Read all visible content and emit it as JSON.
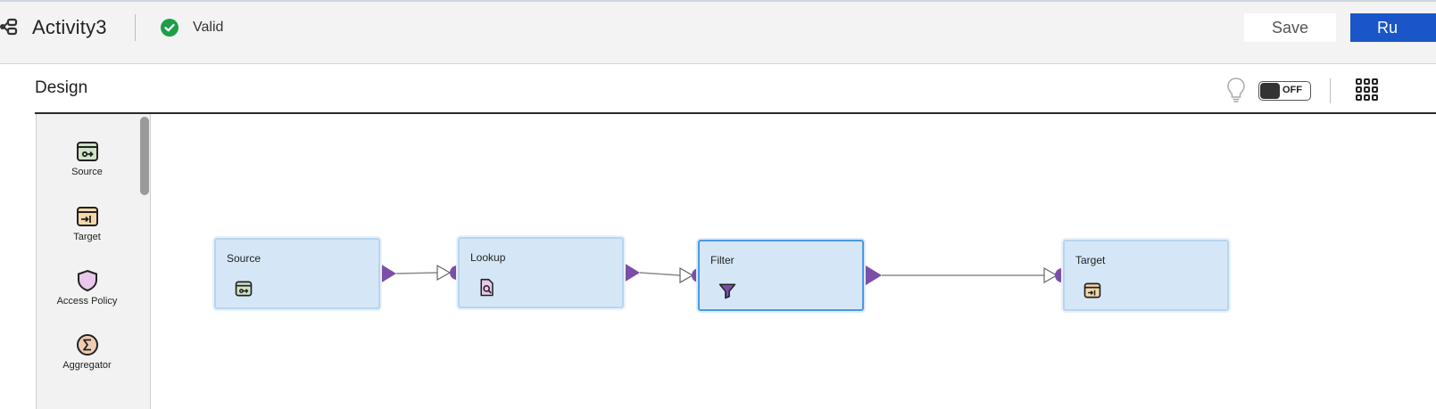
{
  "header": {
    "title": "Activity3",
    "status": "Valid",
    "save_label": "Save",
    "run_label": "Ru",
    "status_color": "#1e9e48",
    "accent_color": "#1b56c8"
  },
  "design": {
    "label": "Design",
    "toggle_label": "OFF",
    "icons": [
      "lightbulb-icon",
      "grid-icon"
    ]
  },
  "palette": {
    "items": [
      {
        "label": "Source",
        "icon": "source-icon"
      },
      {
        "label": "Target",
        "icon": "target-icon"
      },
      {
        "label": "Access Policy",
        "icon": "shield-icon"
      },
      {
        "label": "Aggregator",
        "icon": "sigma-icon"
      }
    ]
  },
  "canvas": {
    "nodes": [
      {
        "title": "Source",
        "icon": "source-icon"
      },
      {
        "title": "Lookup",
        "icon": "lookup-icon"
      },
      {
        "title": "Filter",
        "icon": "filter-icon",
        "selected": true
      },
      {
        "title": "Target",
        "icon": "target-icon"
      }
    ],
    "link_color": "#7b4fa8"
  }
}
